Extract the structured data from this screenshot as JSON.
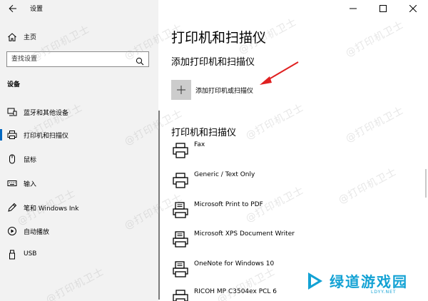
{
  "window": {
    "title": "设置",
    "controls": [
      "minimize",
      "maximize",
      "close"
    ]
  },
  "sidebar": {
    "home_label": "主页",
    "search_placeholder": "查找设置",
    "section_label": "设备",
    "items": [
      {
        "label": "蓝牙和其他设备",
        "icon": "bluetooth-devices-icon",
        "active": false
      },
      {
        "label": "打印机和扫描仪",
        "icon": "printer-icon",
        "active": true
      },
      {
        "label": "鼠标",
        "icon": "mouse-icon",
        "active": false
      },
      {
        "label": "输入",
        "icon": "keyboard-icon",
        "active": false
      },
      {
        "label": "笔和 Windows Ink",
        "icon": "pen-icon",
        "active": false
      },
      {
        "label": "自动播放",
        "icon": "autoplay-icon",
        "active": false
      },
      {
        "label": "USB",
        "icon": "usb-icon",
        "active": false
      }
    ]
  },
  "main": {
    "title": "打印机和扫描仪",
    "add_section_title": "添加打印机和扫描仪",
    "add_button_label": "添加打印机或扫描仪",
    "list_section_title": "打印机和扫描仪",
    "printers": [
      {
        "name": "Fax",
        "icon": "printer-icon"
      },
      {
        "name": "Generic / Text Only",
        "icon": "printer-icon"
      },
      {
        "name": "Microsoft Print to PDF",
        "icon": "pdf-printer-icon"
      },
      {
        "name": "Microsoft XPS Document Writer",
        "icon": "pdf-printer-icon"
      },
      {
        "name": "OneNote for Windows 10",
        "icon": "pdf-printer-icon"
      },
      {
        "name": "RICOH MP C3504ex PCL 6",
        "icon": "printer-icon"
      }
    ]
  },
  "watermark": {
    "text": "@打印机卫士"
  },
  "logo": {
    "text": "绿道游戏园",
    "sub": "LDYY.NET"
  },
  "colors": {
    "sidebar_bg": "#f2f2f2",
    "accent": "#0067c0",
    "arrow": "#e02020",
    "logo": "#13a2d4",
    "add_tile": "#cccccc"
  }
}
